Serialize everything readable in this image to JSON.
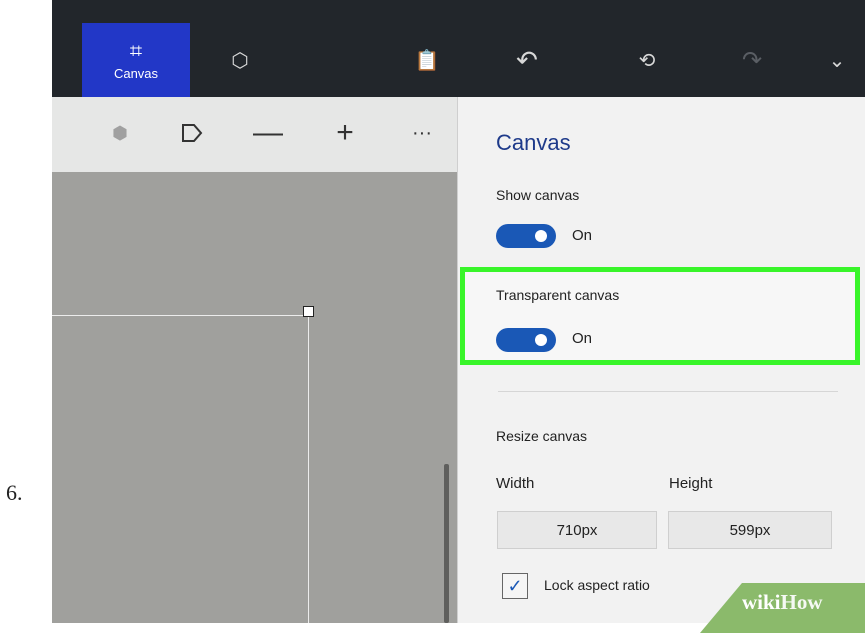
{
  "step_number": "6.",
  "toolbar": {
    "canvas_label": "Canvas",
    "icons": [
      "canvas-crop-icon",
      "3d-library-icon",
      "paste-icon",
      "undo-icon",
      "history-icon",
      "redo-icon",
      "chevron-down-icon"
    ]
  },
  "subtoolbar": {
    "icons": [
      "3d-view-icon",
      "shape-icon",
      "zoom-out-icon",
      "zoom-in-icon",
      "more-icon"
    ]
  },
  "panel": {
    "title": "Canvas",
    "show_canvas": {
      "label": "Show canvas",
      "state": "On"
    },
    "transparent_canvas": {
      "label": "Transparent canvas",
      "state": "On"
    },
    "resize_label": "Resize canvas",
    "width_label": "Width",
    "height_label": "Height",
    "width_value": "710px",
    "height_value": "599px",
    "lock_label": "Lock aspect ratio",
    "lock_checked": true
  },
  "colors": {
    "accent": "#2237c7",
    "toggle_on": "#1a58b6",
    "highlight": "#39f52a",
    "title_blue": "#1e3a8a"
  },
  "watermark": {
    "part1": "wiki",
    "part2": "How"
  }
}
